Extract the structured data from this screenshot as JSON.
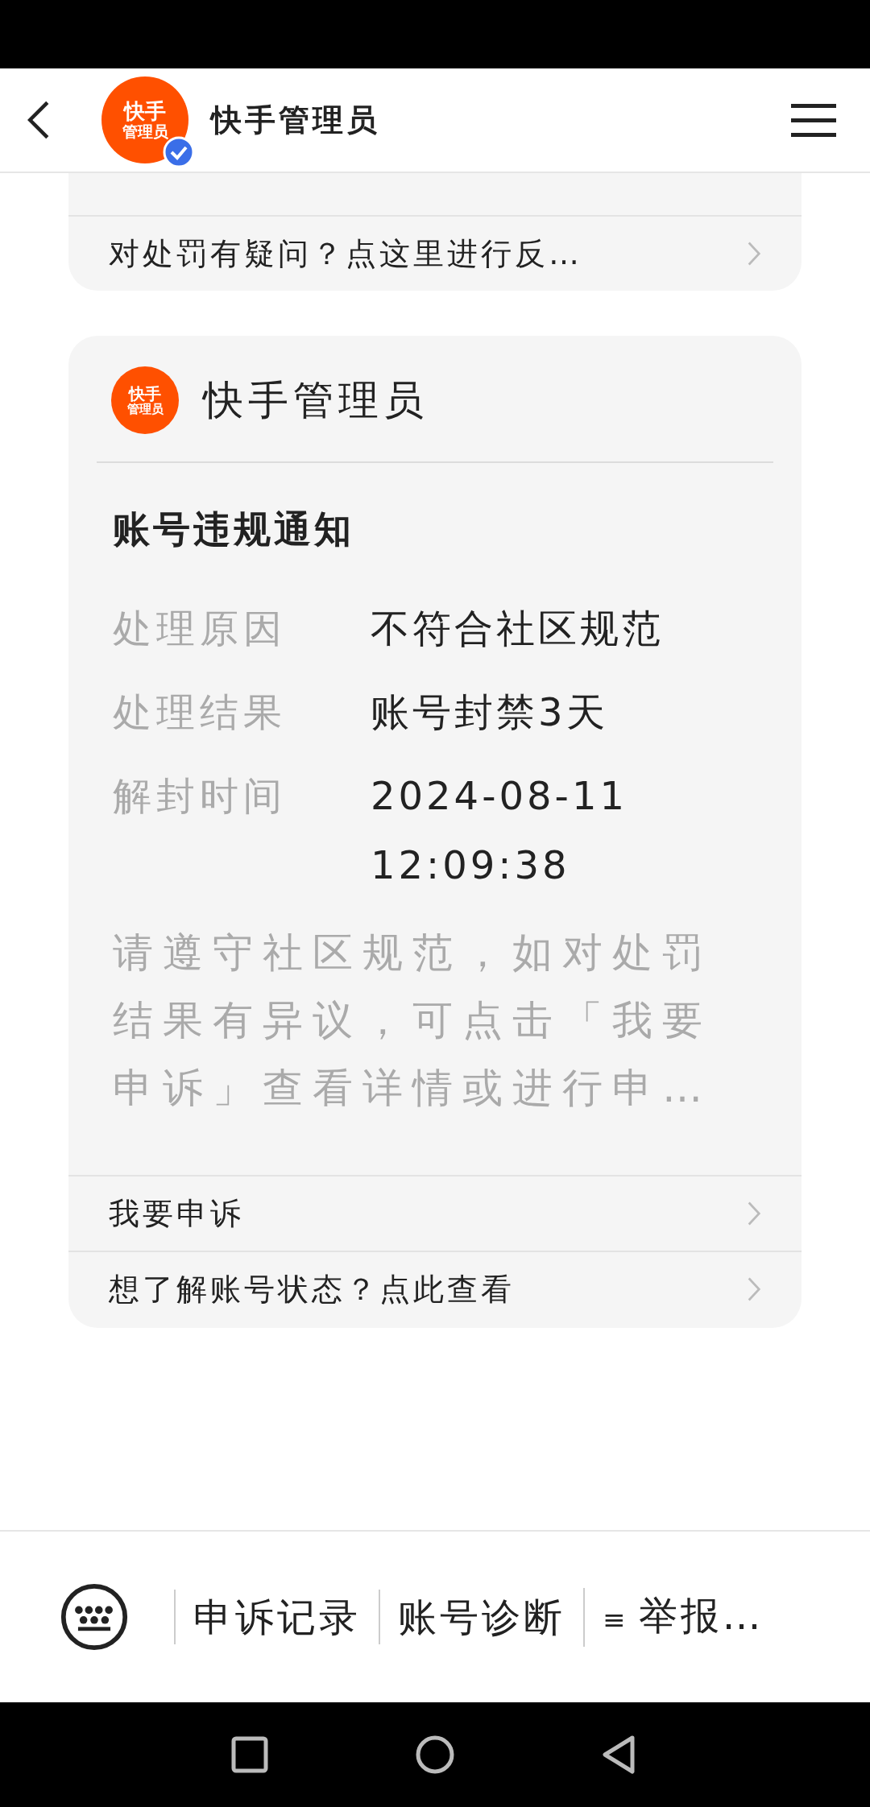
{
  "header": {
    "avatar_text": [
      "快手",
      "管理员"
    ],
    "verified": true,
    "title": "快手管理员"
  },
  "top_card": {
    "link_row": "对处罚有疑问？点这里进行反…"
  },
  "notice_card": {
    "sender": {
      "avatar_text": [
        "快手",
        "管理员"
      ],
      "name": "快手管理员"
    },
    "title": "账号违规通知",
    "details": [
      {
        "label": "处理原因",
        "value": "不符合社区规范"
      },
      {
        "label": "处理结果",
        "value": "账号封禁3天"
      },
      {
        "label": "解封时间",
        "value": "2024-08-11 12:09:38"
      }
    ],
    "message": "请遵守社区规范，如对处罚结果有异议，可点击「我要申诉」查看详情或进行申…",
    "links": [
      "我要申诉",
      "想了解账号状态？点此查看"
    ]
  },
  "bottom_menu": [
    {
      "label": "申诉记录"
    },
    {
      "label": "账号诊断"
    },
    {
      "icon": "≡",
      "label": "举报…"
    }
  ]
}
